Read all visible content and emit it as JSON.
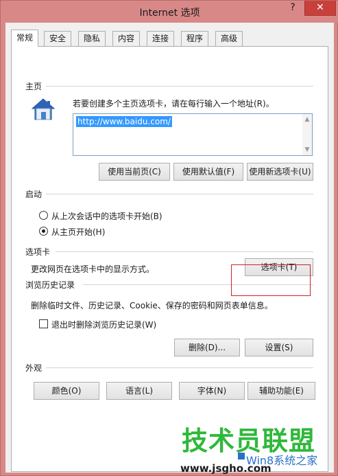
{
  "window": {
    "title": "Internet 选项",
    "help_glyph": "?",
    "close_glyph": "✕"
  },
  "tabs": [
    {
      "label": "常规",
      "active": true
    },
    {
      "label": "安全",
      "active": false
    },
    {
      "label": "隐私",
      "active": false
    },
    {
      "label": "内容",
      "active": false
    },
    {
      "label": "连接",
      "active": false
    },
    {
      "label": "程序",
      "active": false
    },
    {
      "label": "高级",
      "active": false
    }
  ],
  "homepage": {
    "section_label": "主页",
    "icon": "house-icon",
    "instruction": "若要创建多个主页选项卡，请在每行输入一个地址(R)。",
    "url": "http://www.baidu.com/",
    "buttons": {
      "use_current": "使用当前页(C)",
      "use_default": "使用默认值(F)",
      "use_new_tab": "使用新选项卡(U)"
    }
  },
  "startup": {
    "section_label": "启动",
    "options": [
      {
        "label": "从上次会话中的选项卡开始(B)",
        "checked": false
      },
      {
        "label": "从主页开始(H)",
        "checked": true
      }
    ]
  },
  "tabs_section": {
    "section_label": "选项卡",
    "description": "更改网页在选项卡中的显示方式。",
    "button": "选项卡(T)"
  },
  "history": {
    "section_label": "浏览历史记录",
    "description": "删除临时文件、历史记录、Cookie、保存的密码和网页表单信息。",
    "checkbox_label": "退出时删除浏览历史记录(W)",
    "checkbox_checked": false,
    "delete_button": "删除(D)...",
    "settings_button": "设置(S)"
  },
  "appearance": {
    "section_label": "外观",
    "buttons": {
      "colors": "颜色(O)",
      "languages": "语言(L)",
      "fonts": "字体(N)",
      "accessibility": "辅助功能(E)"
    }
  },
  "watermark": {
    "main": "技术员联盟",
    "sub": "Win8系统之家",
    "url": "www.jsgho.com"
  },
  "colors": {
    "frame": "#d98888",
    "close_button": "#c9403a",
    "selection": "#3399ff",
    "highlight_box": "#cc2222",
    "watermark_green": "#2fb83a",
    "watermark_blue": "#2a70c8"
  }
}
